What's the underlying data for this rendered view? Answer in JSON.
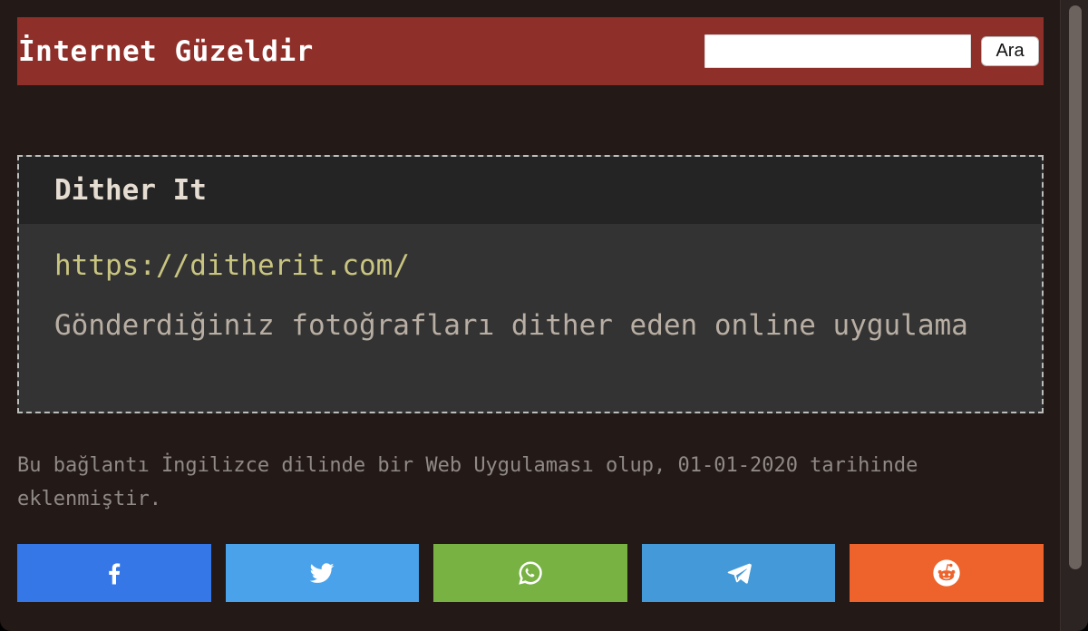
{
  "header": {
    "site_title": "İnternet Güzeldir",
    "search_value": "",
    "search_button_label": "Ara"
  },
  "card": {
    "title": "Dither It",
    "link": "https://ditherit.com/",
    "description": "Gönderdiğiniz fotoğrafları dither eden online uygulama"
  },
  "note": "Bu bağlantı İngilizce dilinde bir Web Uygulaması olup, 01-01-2020 tarihinde eklenmiştir.",
  "share": [
    {
      "network": "facebook",
      "icon": "facebook-icon",
      "color": "#3677e8"
    },
    {
      "network": "twitter",
      "icon": "twitter-icon",
      "color": "#4aa3ea"
    },
    {
      "network": "whatsapp",
      "icon": "whatsapp-icon",
      "color": "#77b243"
    },
    {
      "network": "telegram",
      "icon": "telegram-icon",
      "color": "#449ad8"
    },
    {
      "network": "reddit",
      "icon": "reddit-icon",
      "color": "#ee632b"
    }
  ],
  "colors": {
    "header_bg": "#8f2f29",
    "page_bg": "#231917",
    "card_bg": "#333333",
    "card_header_bg": "#242424",
    "link": "#c9c581"
  }
}
